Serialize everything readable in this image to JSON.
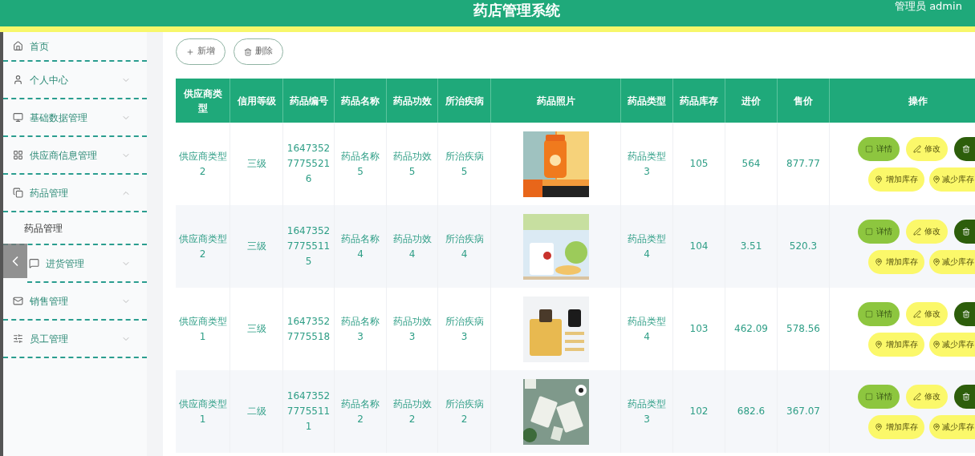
{
  "header": {
    "title": "药店管理系统",
    "user": "管理员 admin"
  },
  "sidebar": {
    "items": [
      {
        "kind": "link",
        "label": "首页"
      },
      {
        "kind": "menu",
        "label": "个人中心",
        "expanded": false
      },
      {
        "kind": "menu",
        "label": "基础数据管理",
        "expanded": false
      },
      {
        "kind": "menu",
        "label": "供应商信息管理",
        "expanded": false
      },
      {
        "kind": "menu",
        "label": "药品管理",
        "expanded": true,
        "children": [
          {
            "label": "药品管理"
          }
        ]
      },
      {
        "kind": "menu",
        "label": "进货管理",
        "expanded": false
      },
      {
        "kind": "menu",
        "label": "销售管理",
        "expanded": false
      },
      {
        "kind": "menu",
        "label": "员工管理",
        "expanded": false
      }
    ]
  },
  "toolbar": [
    {
      "kind": "add",
      "label": "新增"
    },
    {
      "kind": "delete",
      "label": "删除"
    }
  ],
  "table": {
    "columns": [
      "供应商类型",
      "信用等级",
      "药品编号",
      "药品名称",
      "药品功效",
      "所治疾病",
      "药品照片",
      "药品类型",
      "药品库存",
      "进价",
      "售价",
      "操作"
    ],
    "rows": [
      {
        "cells": [
          "供应商类型2",
          "三级",
          "16473527775521 6",
          "药品名称 5",
          "药品功效 5",
          "所治疾病 5",
          {
            "kind": "picture"
          },
          "药品类型 3",
          "105",
          "564",
          "877.77"
        ],
        "actions": [
          {
            "kind": "detail",
            "label": "详情"
          },
          {
            "kind": "edit",
            "label": "修改"
          },
          {
            "kind": "delete"
          },
          {
            "kind": "add_stock",
            "label": "增加库存"
          },
          {
            "kind": "reduce_stock",
            "label": "减少库存"
          }
        ]
      },
      {
        "cells": [
          "供应商类型2",
          "三级",
          "16473527775511 5",
          "药品名称 4",
          "药品功效 4",
          "所治疾病 4",
          {
            "kind": "picture"
          },
          "药品类型 4",
          "104",
          "3.51",
          "520.3"
        ],
        "actions": [
          {
            "kind": "detail",
            "label": "详情"
          },
          {
            "kind": "edit",
            "label": "修改"
          },
          {
            "kind": "delete"
          },
          {
            "kind": "add_stock",
            "label": "增加库存"
          },
          {
            "kind": "reduce_stock",
            "label": "减少库存"
          }
        ]
      },
      {
        "cells": [
          "供应商类型1",
          "三级",
          "16473527775518",
          "药品名称 3",
          "药品功效 3",
          "所治疾病 3",
          {
            "kind": "picture"
          },
          "药品类型 4",
          "103",
          "462.09",
          "578.56"
        ],
        "actions": [
          {
            "kind": "detail",
            "label": "详情"
          },
          {
            "kind": "edit",
            "label": "修改"
          },
          {
            "kind": "delete"
          },
          {
            "kind": "add_stock",
            "label": "增加库存"
          },
          {
            "kind": "reduce_stock",
            "label": "减少库存"
          }
        ]
      },
      {
        "cells": [
          "供应商类型1",
          "二级",
          "16473527775511 1",
          "药品名称 2",
          "药品功效 2",
          "所治疾病 2",
          {
            "kind": "picture"
          },
          "药品类型 3",
          "102",
          "682.6",
          "367.07"
        ],
        "actions": [
          {
            "kind": "detail",
            "label": "详情"
          },
          {
            "kind": "edit",
            "label": "修改"
          },
          {
            "kind": "delete"
          },
          {
            "kind": "add_stock",
            "label": "增加库存"
          },
          {
            "kind": "reduce_stock",
            "label": "减少库存"
          }
        ]
      }
    ]
  }
}
